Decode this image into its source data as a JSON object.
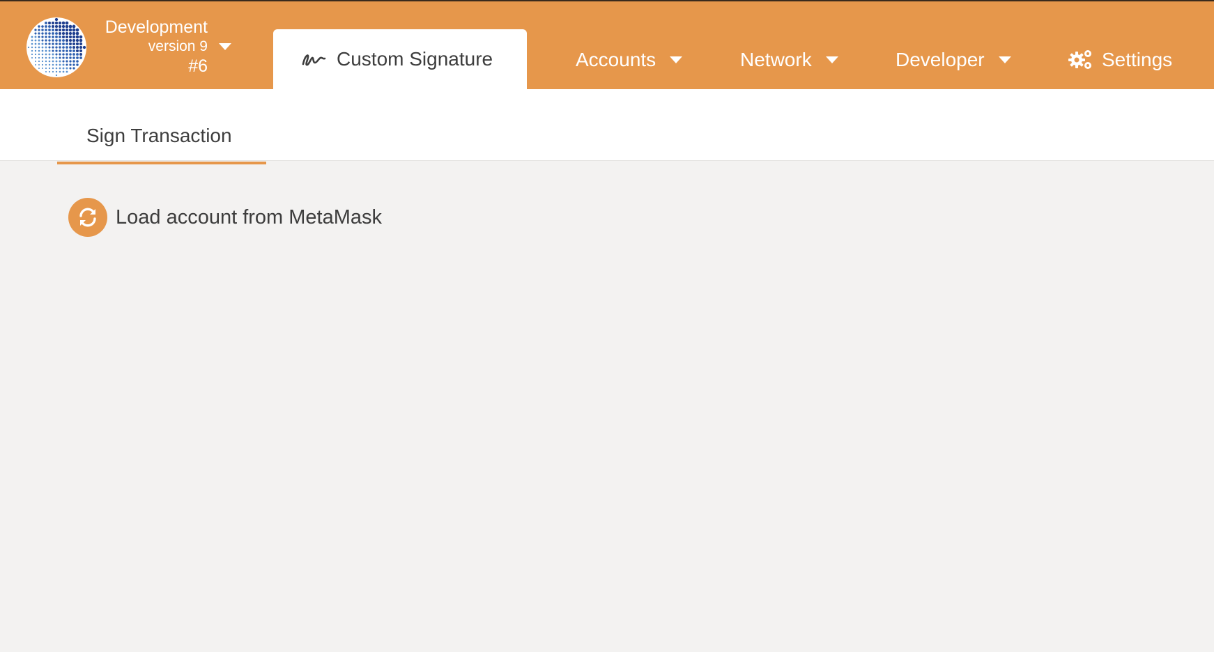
{
  "header": {
    "chain": {
      "name": "Development",
      "version": "version 9",
      "block": "#6"
    },
    "active_tab": {
      "label": "Custom Signature",
      "icon": "signature-icon"
    },
    "nav": {
      "accounts": "Accounts",
      "network": "Network",
      "developer": "Developer",
      "settings": "Settings"
    }
  },
  "subnav": {
    "tabs": [
      {
        "label": "Sign Transaction",
        "active": true
      }
    ]
  },
  "main": {
    "load_button": {
      "label": "Load account from MetaMask",
      "icon": "sync-icon"
    }
  },
  "colors": {
    "accent": "#e6974b",
    "background": "#f3f2f1",
    "text": "#3d3d3d"
  }
}
